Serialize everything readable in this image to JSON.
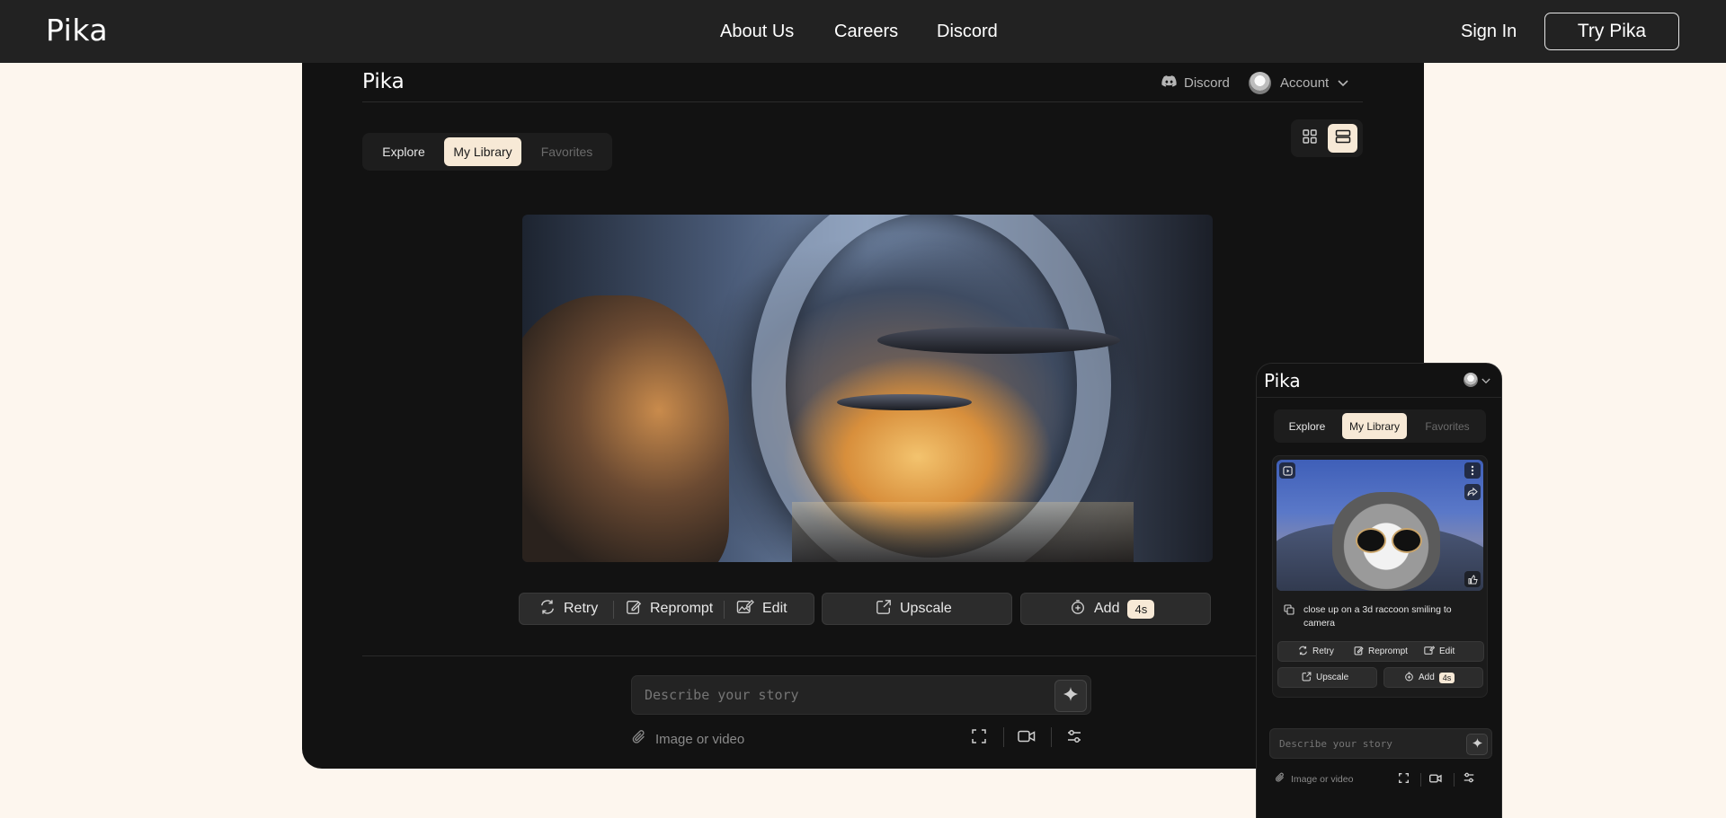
{
  "site": {
    "brand": "Pika",
    "nav": {
      "about": "About Us",
      "careers": "Careers",
      "discord": "Discord"
    },
    "sign_in": "Sign In",
    "try_label": "Try Pika"
  },
  "app": {
    "logo": "Pika",
    "discord_label": "Discord",
    "account_label": "Account",
    "tabs": {
      "explore": "Explore",
      "my_library": "My Library",
      "favorites": "Favorites"
    },
    "actions": {
      "retry": "Retry",
      "reprompt": "Reprompt",
      "edit": "Edit",
      "upscale": "Upscale",
      "add": "Add",
      "add_duration": "4s"
    },
    "prompt_placeholder": "Describe your story",
    "attach_label": "Image or video"
  },
  "mobile": {
    "logo": "Pika",
    "tabs": {
      "explore": "Explore",
      "my_library": "My Library",
      "favorites": "Favorites"
    },
    "card_caption": "close up on a 3d raccoon smiling to camera",
    "actions": {
      "retry": "Retry",
      "reprompt": "Reprompt",
      "edit": "Edit",
      "upscale": "Upscale",
      "add": "Add",
      "add_duration": "4s"
    },
    "prompt_placeholder": "Describe your story",
    "attach_label": "Image or video"
  },
  "colors": {
    "accent": "#f7e9d6",
    "page_bg": "#fdf6ee",
    "nav_bg": "#222222",
    "app_bg": "#121212"
  }
}
